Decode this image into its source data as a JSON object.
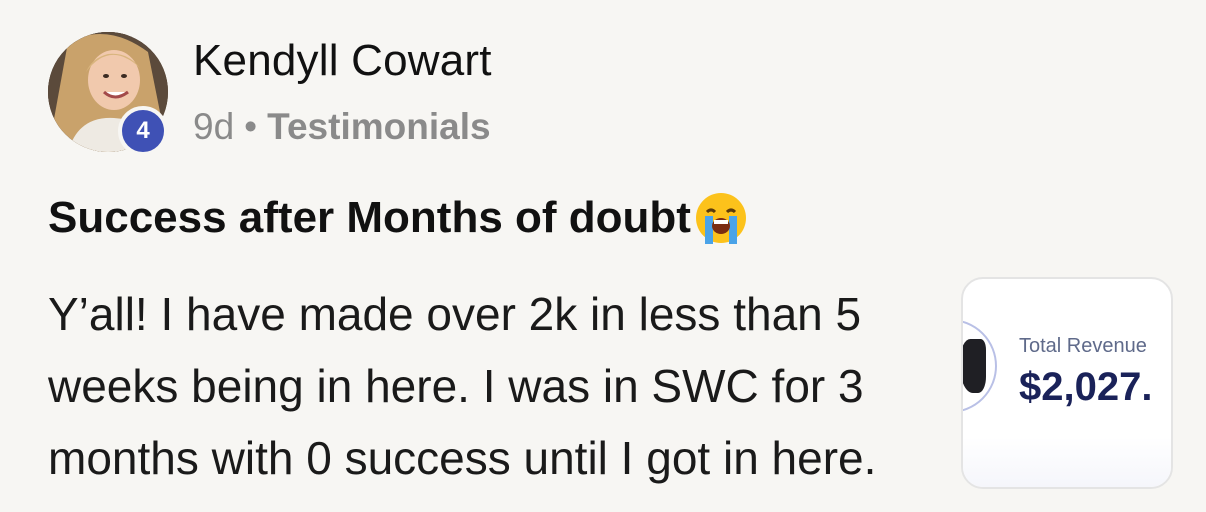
{
  "author": {
    "name": "Kendyll Cowart",
    "level": "4"
  },
  "meta": {
    "time": "9d",
    "separator": "•",
    "category": "Testimonials"
  },
  "post": {
    "title": "Success after Months of doubt",
    "title_emoji": "loudly-crying-face-emoji",
    "body_lines": [
      "Y’all! I have made over 2k in less than 5",
      "weeks being in here. I was in SWC for 3",
      "months with 0 success until I got in here."
    ]
  },
  "attachment": {
    "label": "Total Revenue",
    "value": "$2,027."
  },
  "colors": {
    "background": "#f7f6f3",
    "badge": "#3f51b5",
    "meta_text": "#8a8a8a",
    "revenue_value": "#1a2259"
  }
}
